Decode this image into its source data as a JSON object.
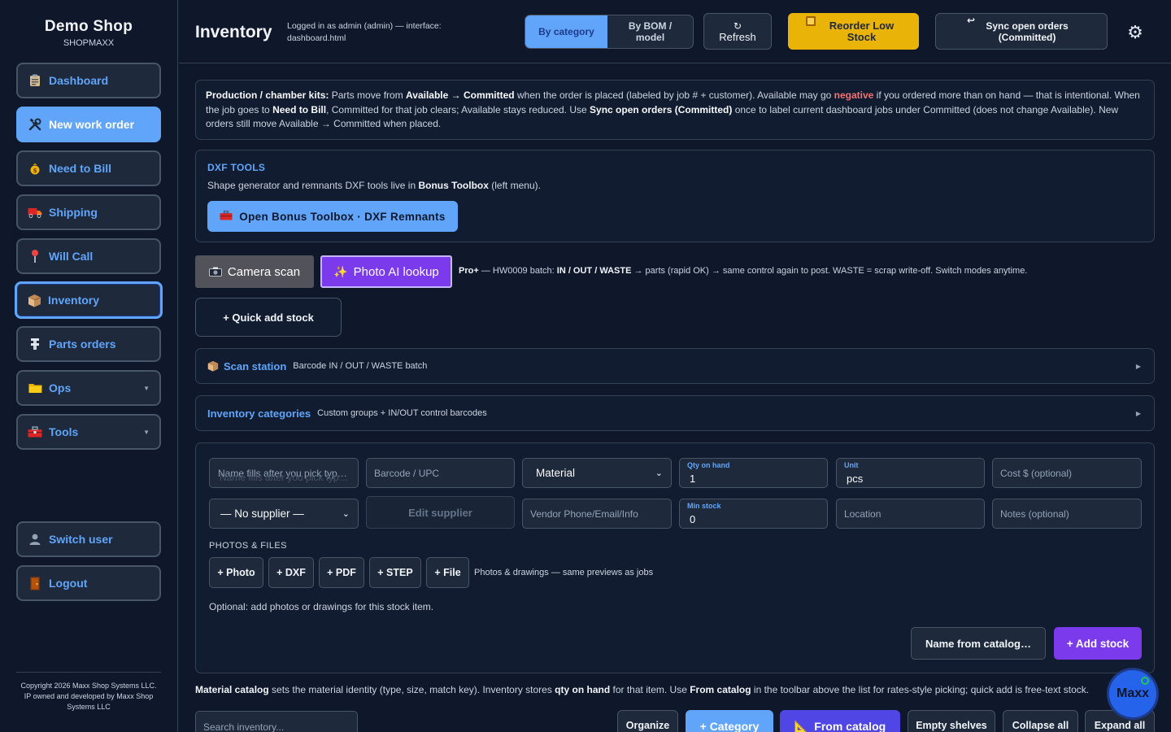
{
  "brand": {
    "title": "Demo Shop",
    "subtitle": "SHOPMAXX"
  },
  "nav": {
    "dashboard": "Dashboard",
    "new_work_order": "New work order",
    "need_to_bill": "Need to Bill",
    "shipping": "Shipping",
    "will_call": "Will Call",
    "inventory": "Inventory",
    "parts_orders": "Parts orders",
    "ops": "Ops",
    "tools": "Tools",
    "switch_user": "Switch user",
    "logout": "Logout"
  },
  "copyright": "Copyright 2026 Maxx Shop Systems LLC. IP owned and developed by Maxx Shop Systems LLC",
  "header": {
    "title": "Inventory",
    "login_info": "Logged in as admin (admin) — interface: dashboard.html",
    "view_by_category": "By category",
    "view_by_bom": "By BOM / model",
    "refresh_icon": "↻",
    "refresh": "Refresh",
    "reorder": "Reorder Low Stock",
    "sync": "Sync open orders (Committed)"
  },
  "info": {
    "t1": "Production / chamber kits:",
    "t2": " Parts move from ",
    "t3": "Available → Committed",
    "t4": " when the order is placed (labeled by job # + customer). Available may go ",
    "t5": "negative",
    "t6": " if you ordered more than on hand — that is intentional. When the job goes to ",
    "t7": "Need to Bill",
    "t8": ", Committed for that job clears; Available stays reduced. Use ",
    "t9": "Sync open orders (Committed)",
    "t10": " once to label current dashboard jobs under Committed (does not change Available). New orders still move Available → Committed when placed."
  },
  "dxf": {
    "title": "DXF TOOLS",
    "t1": "Shape generator and remnants DXF tools live in ",
    "t2": "Bonus Toolbox",
    "t3": " (left menu).",
    "button": "Open Bonus Toolbox · DXF Remnants"
  },
  "scan_row": {
    "camera": "Camera scan",
    "photo_ai": "Photo AI lookup",
    "n1": "Pro+",
    "n2": " — HW0009 batch: ",
    "n3": "IN / OUT / WASTE",
    "n4": " → parts (rapid OK) → same control again to post. WASTE = scrap write-off. Switch modes anytime.",
    "quick_add": "+ Quick add stock"
  },
  "scan_station": {
    "title": "Scan station",
    "subtitle": "Barcode IN / OUT / WASTE batch"
  },
  "inv_categories": {
    "title": "Inventory categories",
    "subtitle": "Custom groups + IN/OUT control barcodes"
  },
  "form": {
    "name_placeholder": "Name fills after you pick typ…",
    "name_ghost": "Name fills after you pick typ…",
    "barcode_placeholder": "Barcode / UPC",
    "material": "Material",
    "qty_label": "Qty on hand",
    "qty_value": "1",
    "unit_label": "Unit",
    "unit_value": "pcs",
    "cost_placeholder": "Cost $ (optional)",
    "supplier": "— No supplier —",
    "edit_supplier": "Edit supplier",
    "vendor_placeholder": "Vendor Phone/Email/Info",
    "min_label": "Min stock",
    "min_value": "0",
    "location_placeholder": "Location",
    "notes_placeholder": "Notes (optional)",
    "photos_label": "PHOTOS & FILES",
    "btn_photo": "+ Photo",
    "btn_dxf": "+ DXF",
    "btn_pdf": "+ PDF",
    "btn_step": "+ STEP",
    "btn_file": "+ File",
    "files_note": "Photos & drawings — same previews as jobs",
    "optional_note": "Optional: add photos or drawings for this stock item.",
    "name_from_catalog": "Name from catalog…",
    "add_stock": "+ Add stock"
  },
  "catalog_note": {
    "c1": "Material catalog",
    "c2": " sets the material identity (type, size, match key). Inventory stores ",
    "c3": "qty on hand",
    "c4": " for that item. Use ",
    "c5": "From catalog",
    "c6": " in the toolbar above the list for rates-style picking; quick add is free-text stock."
  },
  "toolbar": {
    "search_placeholder": "Search inventory...",
    "organize": "Organize",
    "category": "+ Category",
    "from_catalog": "From catalog",
    "empty_shelves": "Empty shelves",
    "collapse_all": "Collapse all",
    "expand_all": "Expand all"
  },
  "assistant": {
    "label": "Maxx"
  }
}
